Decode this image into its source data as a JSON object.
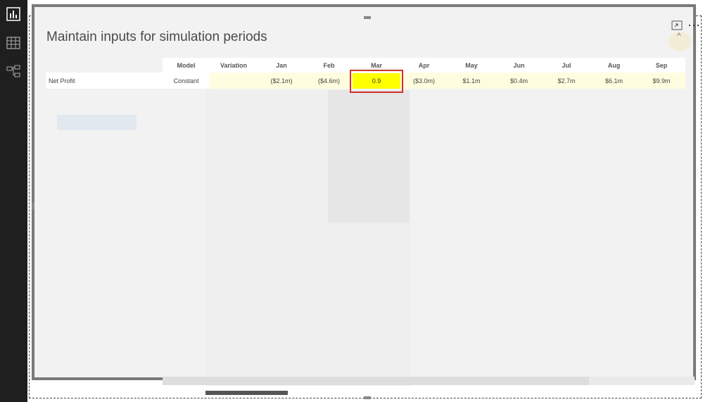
{
  "rail": {
    "items": [
      {
        "name": "report-view-icon"
      },
      {
        "name": "data-view-icon"
      },
      {
        "name": "model-view-icon"
      }
    ]
  },
  "dialog": {
    "title": "Maintain inputs for simulation periods"
  },
  "grid": {
    "columns": [
      "Model",
      "Variation",
      "Jan",
      "Feb",
      "Mar",
      "Apr",
      "May",
      "Jun",
      "Jul",
      "Aug",
      "Sep"
    ],
    "row": {
      "label": "Net Profit",
      "model": "Constant",
      "variation": "",
      "values": [
        "($2.1m)",
        "($4.6m)",
        "0.9",
        "($3.0m)",
        "$1.1m",
        "$0.4m",
        "$2.7m",
        "$6.1m",
        "$9.9m"
      ]
    }
  },
  "colors": {
    "edit_cell": "#ffff00",
    "highlight_border": "#d0312d",
    "row_tint": "#fffde0",
    "rail": "#1f1f1f"
  }
}
